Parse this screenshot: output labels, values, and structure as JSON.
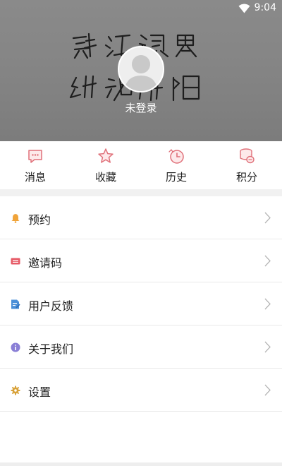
{
  "status": {
    "time": "9:04"
  },
  "profile": {
    "login_text": "未登录"
  },
  "quick_actions": [
    {
      "label": "消息",
      "icon": "message-icon"
    },
    {
      "label": "收藏",
      "icon": "star-icon"
    },
    {
      "label": "历史",
      "icon": "clock-icon"
    },
    {
      "label": "积分",
      "icon": "coins-icon"
    }
  ],
  "menu": [
    {
      "label": "预约",
      "icon": "bell-icon"
    },
    {
      "label": "邀请码",
      "icon": "ticket-icon"
    },
    {
      "label": "用户反馈",
      "icon": "feedback-icon"
    },
    {
      "label": "关于我们",
      "icon": "info-icon"
    },
    {
      "label": "设置",
      "icon": "gear-icon"
    }
  ],
  "colors": {
    "header_bg": "#858585",
    "icon_red": "#e0717a",
    "bell": "#f0a43a",
    "ticket": "#e65a66",
    "feedback": "#4a8fd8",
    "info": "#8a7fd6",
    "gear": "#d8a23a"
  }
}
